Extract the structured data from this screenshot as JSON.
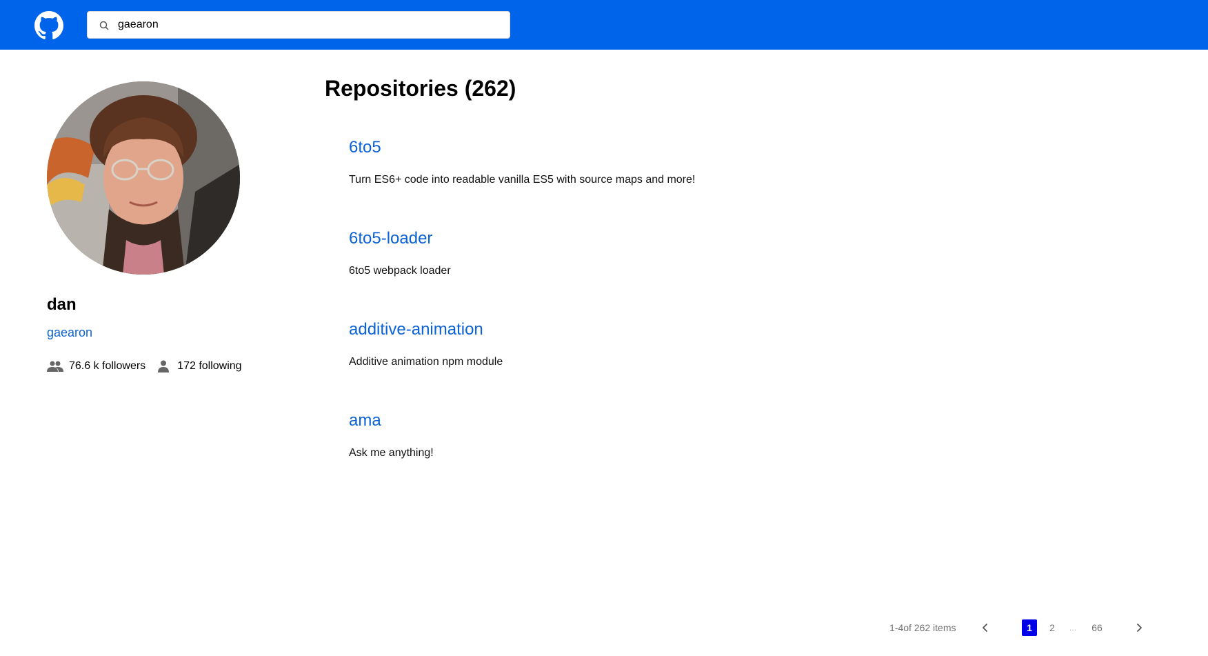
{
  "header": {
    "logo_icon": "github-octocat-icon",
    "search": {
      "icon": "search-icon",
      "value": "gaearon",
      "placeholder": ""
    }
  },
  "profile": {
    "avatar_icon": "user-avatar-photo",
    "name": "dan",
    "login": "gaearon",
    "followers_icon": "group-icon",
    "followers_text": "76.6 k followers",
    "following_icon": "person-icon",
    "following_text": "172 following"
  },
  "repositories": {
    "title": "Repositories (262)",
    "items": [
      {
        "name": "6to5",
        "description": "Turn ES6+ code into readable vanilla ES5 with source maps and more!"
      },
      {
        "name": "6to5-loader",
        "description": "6to5 webpack loader"
      },
      {
        "name": "additive-animation",
        "description": "Additive animation npm module"
      },
      {
        "name": "ama",
        "description": "Ask me anything!"
      }
    ]
  },
  "pagination": {
    "total_text": "1-4of 262 items",
    "pages": [
      "1",
      "2",
      "66"
    ],
    "ellipsis": "...",
    "current_page": "1",
    "prev_icon": "chevron-left-icon",
    "next_icon": "chevron-right-icon"
  },
  "colors": {
    "header_bg": "#0064eb",
    "link": "#0b62d6",
    "active_page": "#0000e8"
  }
}
